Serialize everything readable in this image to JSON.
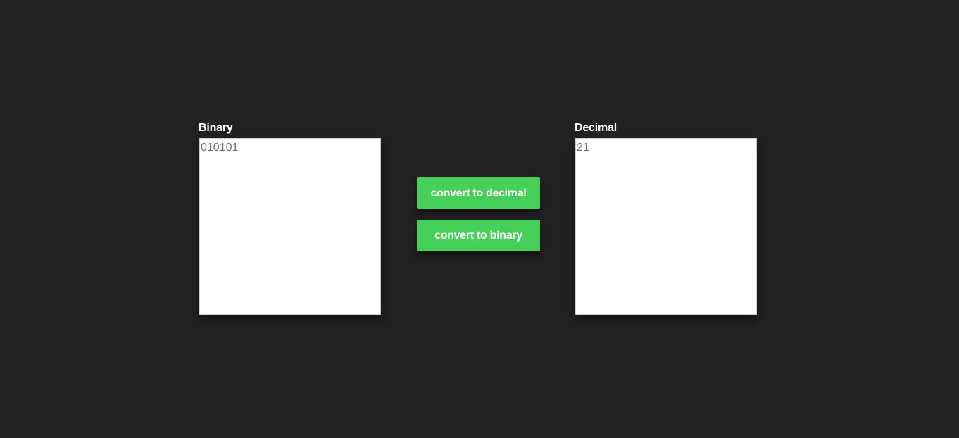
{
  "binary_panel": {
    "label": "Binary",
    "value": "010101"
  },
  "decimal_panel": {
    "label": "Decimal",
    "value": "21"
  },
  "actions": {
    "to_decimal_label": "convert to decimal",
    "to_binary_label": "convert to binary"
  },
  "colors": {
    "background": "#232122",
    "button": "#47d059",
    "box": "#ffffff",
    "text_value": "#6f6f6f"
  }
}
